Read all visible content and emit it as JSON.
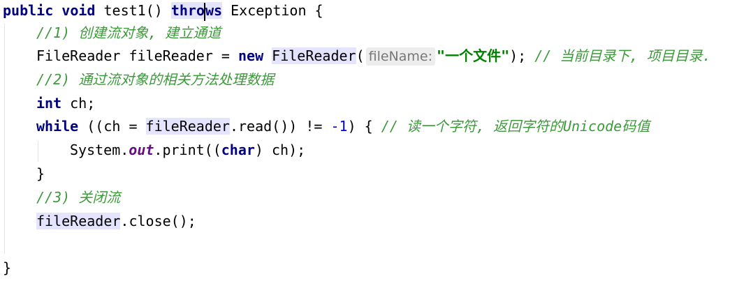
{
  "code": {
    "l1": {
      "a": "public void",
      "b": " test1() ",
      "c": "thro",
      "d": "ws",
      "e": " Exception {"
    },
    "l2": {
      "comment": "//1) 创建流对象, 建立通道"
    },
    "l3": {
      "a": "FileReader fileReader = ",
      "b": "new",
      "c": " ",
      "d": "FileReader",
      "e": "(",
      "hint": "fileName:",
      "str": "\"一个文件\"",
      "f": "); ",
      "comment": "// 当前目录下, 项目目录."
    },
    "l4": {
      "comment": "//2) 通过流对象的相关方法处理数据"
    },
    "l5": {
      "kw": "int",
      "rest": " ch;"
    },
    "l6": {
      "kw": "while",
      "a": " ((ch = ",
      "b": "fileReader",
      "c": ".read()) != ",
      "num": "-1",
      "d": ") { ",
      "comment": "// 读一个字符, 返回字符的Unicode码值"
    },
    "l7": {
      "a": "System.",
      "field": "out",
      "b": ".print((",
      "kw": "char",
      "c": ") ch);"
    },
    "l8": {
      "a": "}"
    },
    "l9": {
      "comment": "//3) 关闭流"
    },
    "l10": {
      "a": "fileReader",
      "b": ".close();"
    },
    "l12": {
      "a": "}"
    }
  }
}
